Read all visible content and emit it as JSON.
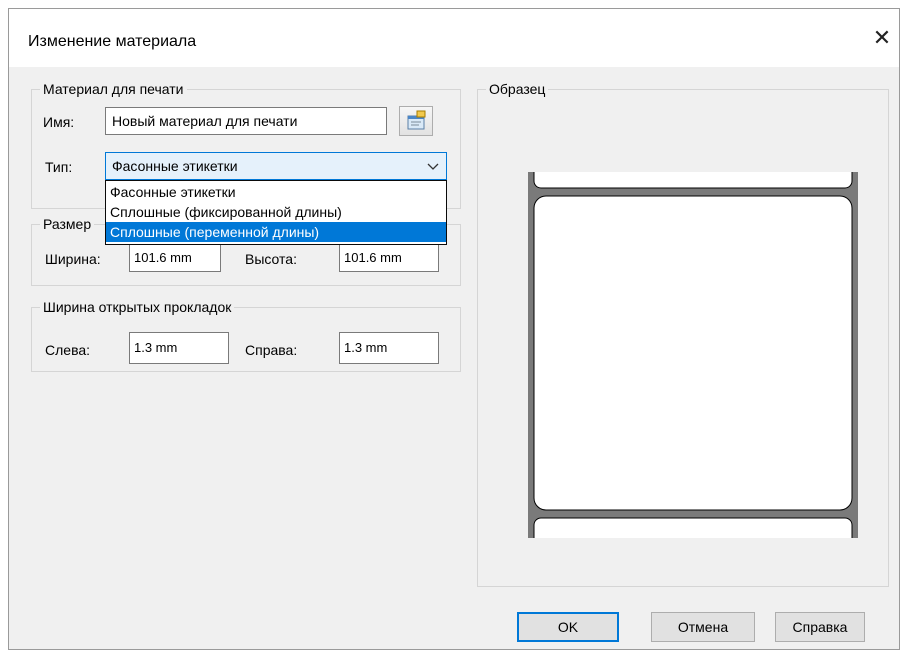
{
  "dialog": {
    "title": "Изменение материала",
    "close_glyph": "✕"
  },
  "print_material": {
    "legend": "Материал для печати",
    "name_label": "Имя:",
    "name_value": "Новый материал для печати",
    "type_label": "Тип:",
    "type_value": "Фасонные этикетки",
    "type_options": [
      "Фасонные этикетки",
      "Сплошные (фиксированной длины)",
      "Сплошные (переменной длины)"
    ],
    "highlighted_option_index": 2,
    "properties_icon": "properties-icon"
  },
  "size": {
    "legend": "Размер",
    "width_label": "Ширина:",
    "width_value": "101.6 mm",
    "height_label": "Высота:",
    "height_value": "101.6 mm"
  },
  "gaps": {
    "legend": "Ширина открытых прокладок",
    "left_label": "Слева:",
    "left_value": "1.3 mm",
    "right_label": "Справа:",
    "right_value": "1.3 mm"
  },
  "sample": {
    "legend": "Образец"
  },
  "buttons": {
    "ok": "OK",
    "cancel": "Отмена",
    "help": "Справка"
  },
  "colors": {
    "accent": "#0078d7",
    "dialog_bg": "#f0f0f0",
    "liner": "#7a7a7a"
  }
}
